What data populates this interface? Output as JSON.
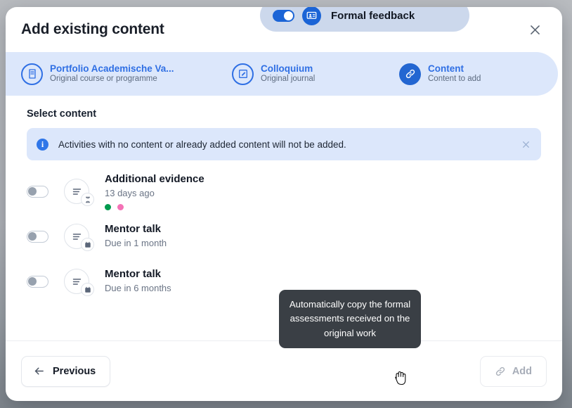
{
  "modal": {
    "title": "Add existing content",
    "close_icon": "close-icon"
  },
  "stepper": {
    "steps": [
      {
        "title": "Portfolio Academische Va...",
        "subtitle": "Original course or programme",
        "icon": "book-icon",
        "state": "outline"
      },
      {
        "title": "Colloquium",
        "subtitle": "Original journal",
        "icon": "edit-document-icon",
        "state": "outline"
      },
      {
        "title": "Content",
        "subtitle": "Content to add",
        "icon": "link-icon",
        "state": "filled"
      }
    ]
  },
  "body": {
    "section_title": "Select content",
    "info_banner": {
      "icon": "info-icon",
      "text": "Activities with no content or already added content will not be added.",
      "close_icon": "close-icon"
    },
    "items": [
      {
        "title": "Additional evidence",
        "subtitle": "13 days ago",
        "toggle": "off",
        "icon": "document-lines-icon",
        "badge_icon": "hourglass-icon",
        "dots": [
          "#009a4e",
          "#f472b6"
        ]
      },
      {
        "title": "Mentor talk",
        "subtitle": "Due in 1 month",
        "toggle": "off",
        "icon": "document-lines-icon",
        "badge_icon": "calendar-icon",
        "dots": []
      },
      {
        "title": "Mentor talk",
        "subtitle": "Due in 6 months",
        "toggle": "off",
        "icon": "document-lines-icon",
        "badge_icon": "calendar-icon",
        "dots": []
      }
    ]
  },
  "tooltip": {
    "text": "Automatically copy the formal assessments received on the original work"
  },
  "footer": {
    "previous_label": "Previous",
    "previous_icon": "arrow-left-icon",
    "feedback_label": "Formal feedback",
    "feedback_icon": "presentation-person-icon",
    "feedback_toggle": "on",
    "add_label": "Add",
    "add_icon": "link-icon",
    "add_disabled": true
  },
  "colors": {
    "accent": "#2366d1",
    "band": "#dce7fb",
    "pill": "#ccd8ec",
    "tooltip_bg": "#3a3f45"
  }
}
